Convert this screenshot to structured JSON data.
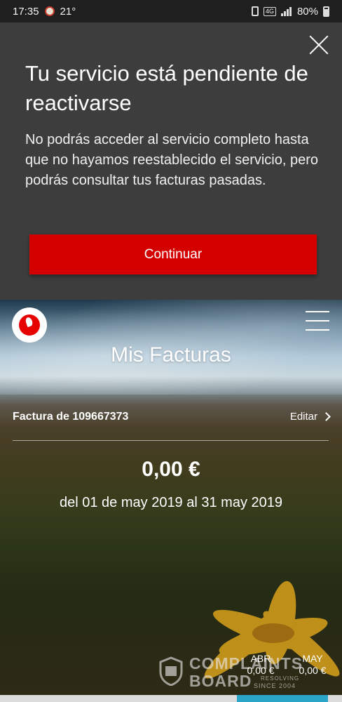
{
  "status_bar": {
    "time": "17:35",
    "temperature": "21°",
    "battery": "80%",
    "icons": [
      "weather-icon",
      "vibrate-icon",
      "lte-icon",
      "signal-icon",
      "battery-icon"
    ]
  },
  "modal": {
    "title": "Tu servicio está pendiente de reactivarse",
    "body": "No podrás acceder al servicio completo hasta que no hayamos reestablecido el servicio, pero podrás consultar tus facturas pasadas.",
    "button_label": "Continuar",
    "button_color": "#d40000",
    "background_color": "#3d3d3d"
  },
  "header": {
    "title": "Mis Facturas",
    "logo_color": "#e60000"
  },
  "bill": {
    "label": "Factura de 109667373",
    "edit_label": "Editar",
    "amount": "0,00 €",
    "period": "del 01 de may 2019 al 31 may 2019"
  },
  "months": [
    {
      "label": "ABR",
      "value": "0,00 €"
    },
    {
      "label": "MAY",
      "value": "0,00 €"
    }
  ],
  "watermark": {
    "line1": "COMPLAINTS",
    "line2": "BOARD",
    "tagline": "RESOLVING",
    "since": "SINCE 2004"
  }
}
